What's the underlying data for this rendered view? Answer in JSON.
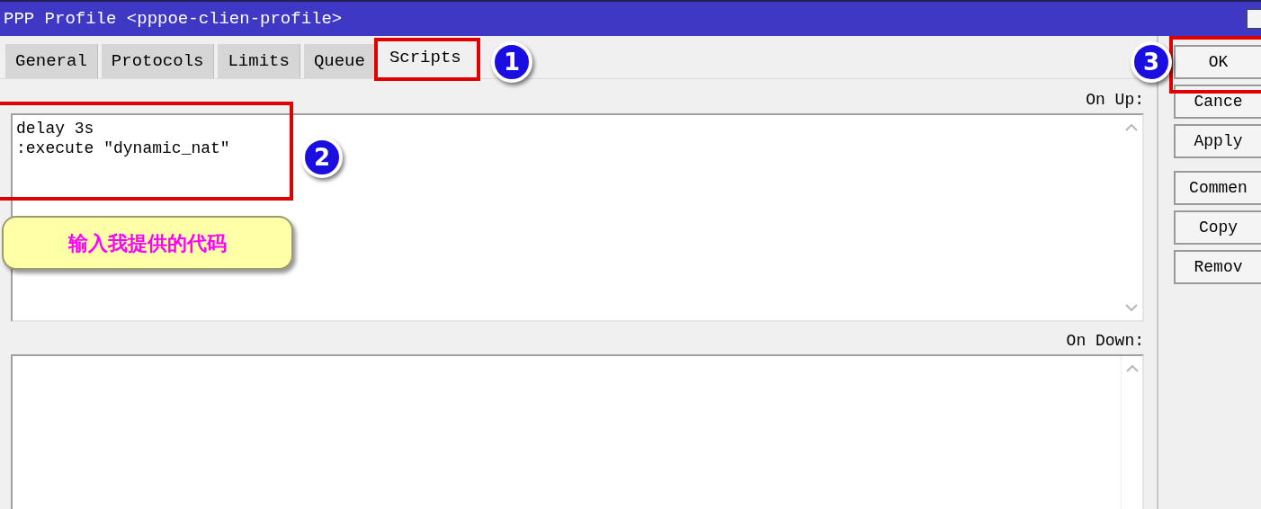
{
  "window": {
    "title": "PPP Profile <pppoe-clien-profile>"
  },
  "tabs": [
    {
      "label": "General",
      "selected": false
    },
    {
      "label": "Protocols",
      "selected": false
    },
    {
      "label": "Limits",
      "selected": false
    },
    {
      "label": "Queue",
      "selected": false
    },
    {
      "label": "Scripts",
      "selected": true
    }
  ],
  "on_up": {
    "label": "On Up:",
    "value": "delay 3s\n:execute \"dynamic_nat\""
  },
  "on_down": {
    "label": "On Down:"
  },
  "buttons": [
    {
      "label": "OK"
    },
    {
      "label": "Cance"
    },
    {
      "label": "Apply"
    },
    {
      "label": "Commen"
    },
    {
      "label": "Copy"
    },
    {
      "label": "Remov"
    }
  ],
  "annotations": {
    "markers": [
      "1",
      "2",
      "3"
    ],
    "callout": "输入我提供的代码"
  }
}
